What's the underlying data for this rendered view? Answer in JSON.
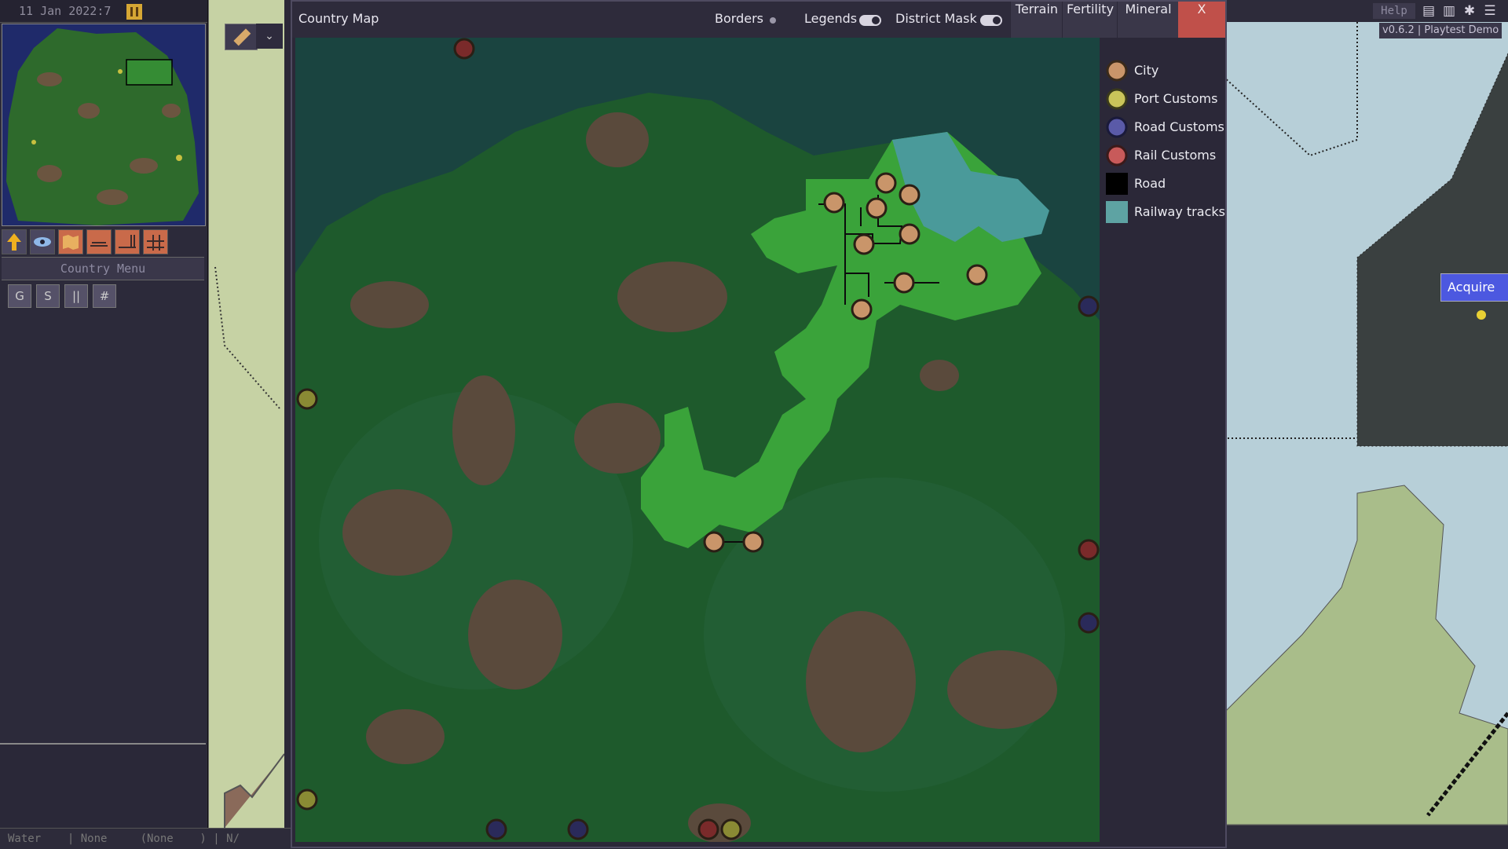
{
  "date": {
    "text": "11 Jan 2022:7"
  },
  "sidebar": {
    "country_menu_label": "Country Menu",
    "tools": [
      "arrow-up-icon",
      "eye-icon",
      "map-icon",
      "rail-icon",
      "rail-bridge-icon",
      "rail-cross-icon"
    ],
    "subtools": [
      "G",
      "S",
      "||",
      "#"
    ]
  },
  "status_bar": {
    "text": "Water    | None     (None    ) | N/"
  },
  "top_right": {
    "help_label": "Help",
    "version": "v0.6.2 | Playtest Demo"
  },
  "world": {
    "acquire_label": "Acquire"
  },
  "dialog": {
    "title": "Country Map",
    "borders_label": "Borders",
    "legends_label": "Legends",
    "district_mask_label": "District Mask",
    "tabs": [
      "Terrain",
      "Fertility",
      "Mineral"
    ],
    "close_label": "X"
  },
  "legend": {
    "items": [
      {
        "label": "City",
        "color": "#c9956a",
        "kind": "circle"
      },
      {
        "label": "Port Customs",
        "color": "#c9c45a",
        "kind": "circle"
      },
      {
        "label": "Road Customs",
        "color": "#5a5aa8",
        "kind": "circle"
      },
      {
        "label": "Rail Customs",
        "color": "#c85a5a",
        "kind": "circle"
      },
      {
        "label": "Road",
        "color": "#000000",
        "kind": "square"
      },
      {
        "label": "Railway tracks",
        "color": "#5ea3a3",
        "kind": "square"
      }
    ]
  },
  "colors": {
    "water": "#1c4a47",
    "land": "#1e5a2c",
    "land_alt": "#24603a",
    "highland": "#5a4a3c",
    "district": "#3aa33a",
    "rail_water": "#4a9a9a",
    "close": "#c0504a",
    "accent_button": "#4c58e0"
  }
}
